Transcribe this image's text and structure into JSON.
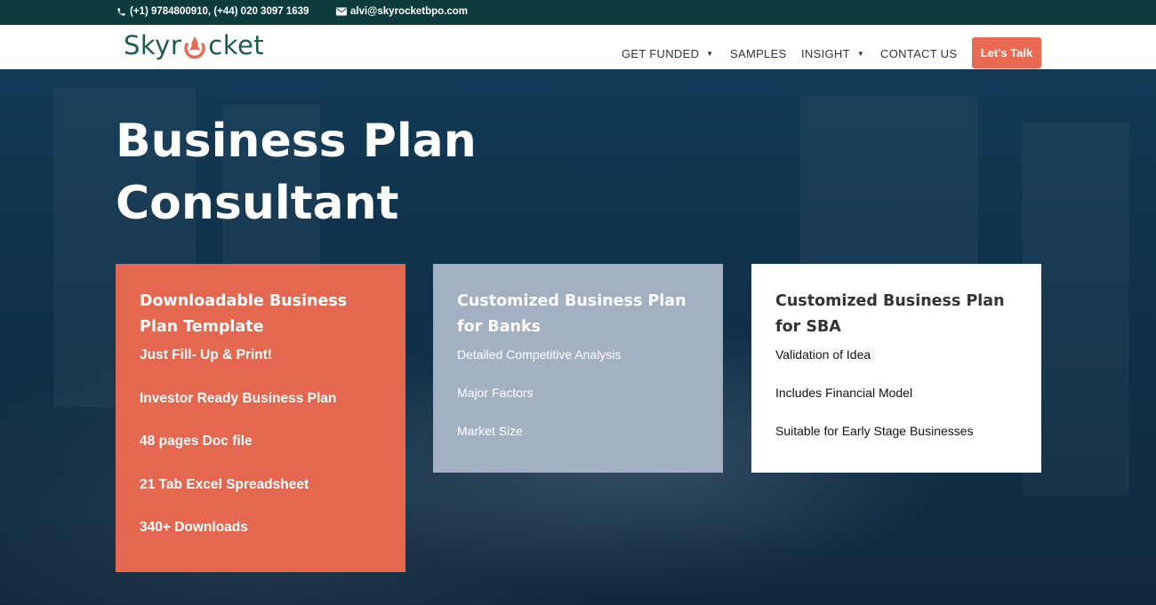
{
  "topbar": {
    "phone": "(+1) 9784800910, (+44) 020 3097 1639",
    "email": "alvi@skyrocketbpo.com"
  },
  "header": {
    "logo_prefix": "Skyr",
    "logo_suffix": "cket",
    "nav": {
      "get_funded": "GET FUNDED",
      "samples": "SAMPLES",
      "insight": "INSIGHT",
      "contact": "CONTACT US"
    },
    "cta": "Let's Talk"
  },
  "hero": {
    "title_line1": "Business Plan",
    "title_line2": "Consultant"
  },
  "cards": [
    {
      "title": "Downloadable Business Plan Template",
      "items": [
        "Just Fill- Up & Print!",
        "Investor Ready Business Plan",
        "48 pages Doc file",
        "21 Tab Excel Spreadsheet",
        "340+ Downloads"
      ]
    },
    {
      "title": "Customized Business Plan for Banks",
      "items": [
        "Detailed Competitive Analysis",
        "Major Factors",
        "Market Size"
      ]
    },
    {
      "title": "Customized Business Plan for SBA",
      "items": [
        "Validation of Idea",
        "Includes Financial Model",
        "Suitable for Early Stage Businesses"
      ]
    }
  ],
  "colors": {
    "topbar": "#0e3b3b",
    "accent": "#e86a52",
    "logo": "#1e5a4b",
    "card_banks": "#a3b0c1"
  },
  "icons": {
    "phone": "phone-icon",
    "email": "envelope-icon",
    "dropdown": "caret-down-icon"
  }
}
